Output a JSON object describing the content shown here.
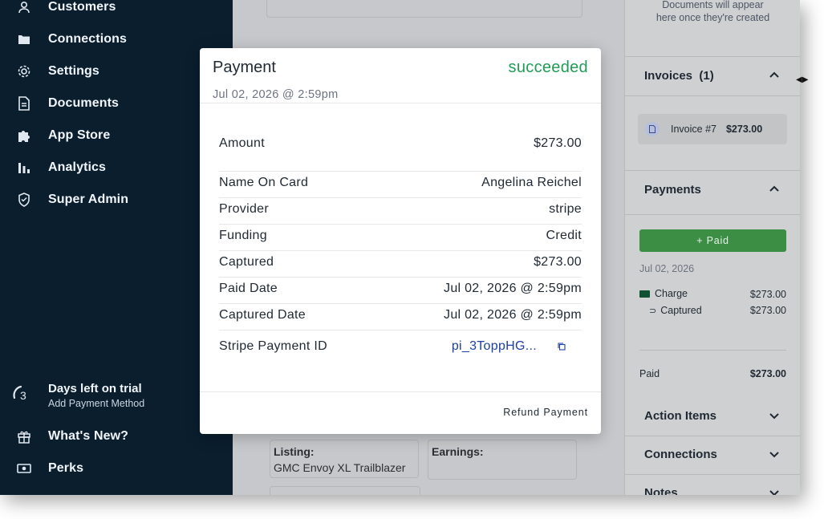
{
  "sidebar": {
    "items": [
      {
        "label": "Customers",
        "icon": "user-icon"
      },
      {
        "label": "Connections",
        "icon": "folder-icon"
      },
      {
        "label": "Settings",
        "icon": "gear-icon"
      },
      {
        "label": "Documents",
        "icon": "document-icon"
      },
      {
        "label": "App Store",
        "icon": "puzzle-icon"
      },
      {
        "label": "Analytics",
        "icon": "bar-chart-icon"
      },
      {
        "label": "Super Admin",
        "icon": "shield-icon"
      }
    ],
    "trial": {
      "days": "3",
      "title": "Days left on trial",
      "subtitle": "Add Payment Method"
    },
    "bottom_items": [
      {
        "label": "What's New?",
        "icon": "gift-icon"
      },
      {
        "label": "Perks",
        "icon": "money-icon"
      }
    ]
  },
  "main": {
    "listing_label": "Listing:",
    "listing_value": "GMC Envoy XL Trailblazer",
    "earnings_label": "Earnings:"
  },
  "right_panel": {
    "docs_note_line1": "Documents will appear",
    "docs_note_line2": "here once they're created",
    "invoices_title": "Invoices",
    "invoices_count": "(1)",
    "invoice_label": "Invoice #7",
    "invoice_amount": "$273.00",
    "payments_title": "Payments",
    "paid_button": "+ Paid",
    "payment_date": "Jul 02, 2026",
    "charge_label": "Charge",
    "charge_amount": "$273.00",
    "captured_label": "Captured",
    "captured_amount": "$273.00",
    "paid_label": "Paid",
    "paid_total": "$273.00",
    "action_items_title": "Action Items",
    "connections_title": "Connections",
    "notes_title": "Notes"
  },
  "modal": {
    "title": "Payment",
    "status": "succeeded",
    "status_color": "#1f9d55",
    "date": "Jul 02, 2026 @ 2:59pm",
    "amount_label": "Amount",
    "amount_value": "$273.00",
    "rows": [
      {
        "label": "Name On Card",
        "value": "Angelina Reichel"
      },
      {
        "label": "Provider",
        "value": "stripe"
      },
      {
        "label": "Funding",
        "value": "Credit"
      },
      {
        "label": "Captured",
        "value": "$273.00"
      },
      {
        "label": "Paid Date",
        "value": "Jul 02, 2026 @ 2:59pm"
      },
      {
        "label": "Captured Date",
        "value": "Jul 02, 2026 @ 2:59pm"
      }
    ],
    "stripe_label": "Stripe Payment ID",
    "stripe_value": "pi_3ToppHG...",
    "refund_button": "Refund Payment"
  }
}
